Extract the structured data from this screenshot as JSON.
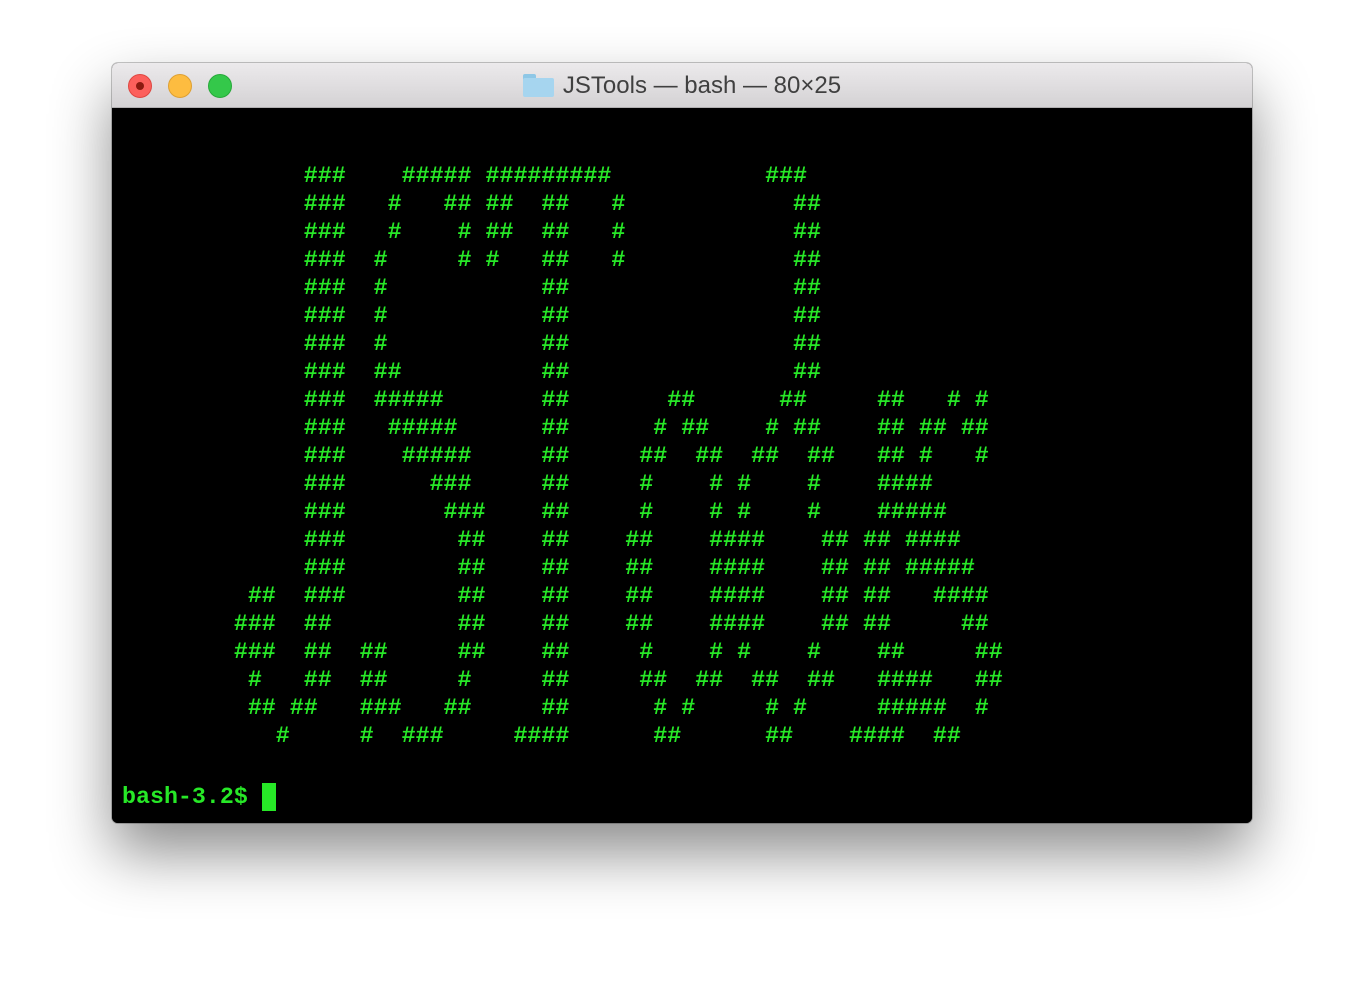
{
  "window": {
    "title": "JSTools — bash — 80×25"
  },
  "terminal": {
    "ascii_art": "             ###    ##### #########           ###\n             ###   #   ## ##  ##   #            ##\n             ###   #    # ##  ##   #            ##\n             ###  #     # #   ##   #            ##\n             ###  #           ##                ##\n             ###  #           ##                ##\n             ###  #           ##                ##\n             ###  ##          ##                ##\n             ###  #####       ##       ##      ##     ##   # #\n             ###   #####      ##      # ##    # ##    ## ## ##\n             ###    #####     ##     ##  ##  ##  ##   ## #   #\n             ###      ###     ##     #    # #    #    ####\n             ###       ###    ##     #    # #    #    #####\n             ###        ##    ##    ##    ####    ## ## ####\n             ###        ##    ##    ##    ####    ## ## #####\n         ##  ###        ##    ##    ##    ####    ## ##   ####\n        ###  ##         ##    ##    ##    ####    ## ##     ##\n        ###  ##  ##     ##    ##     #    # #    #    ##     ##\n         #   ##  ##     #     ##     ##  ##  ##  ##   ####   ##\n         ## ##   ###   ##     ##      # #     # #     #####  #\n           #     #  ###     ####      ##      ##    ####  ##",
    "prompt": "bash-3.2$ "
  }
}
